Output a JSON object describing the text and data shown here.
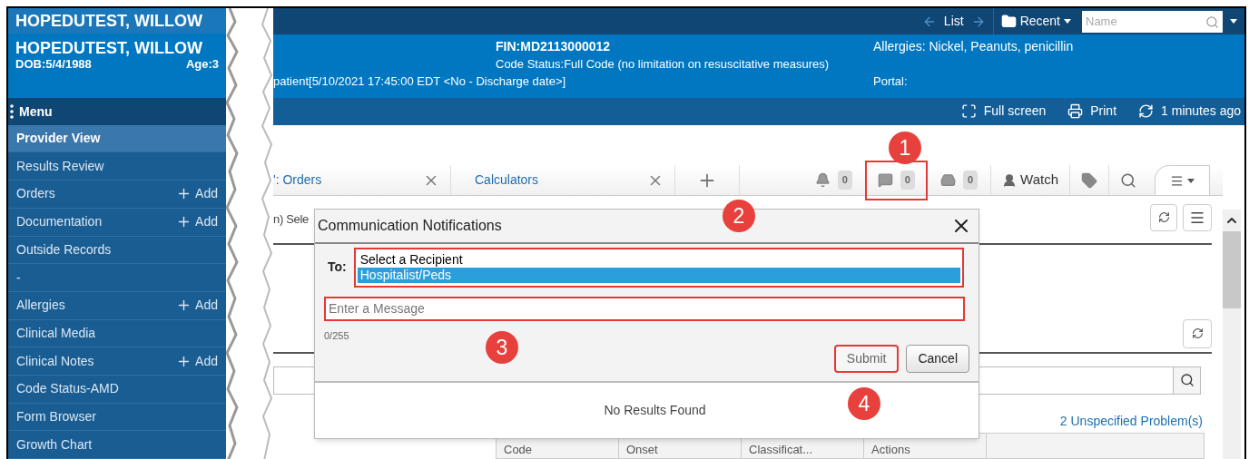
{
  "header": {
    "patient_name": "HOPEDUTEST, WILLOW",
    "nav": {
      "list": "List",
      "recent": "Recent",
      "search_placeholder": "Name"
    }
  },
  "banner": {
    "name": "HOPEDUTEST, WILLOW",
    "dob": "DOB:5/4/1988",
    "age": "Age:3",
    "encounter": "patient[5/10/2021 17:45:00 EDT <No - Discharge date>]",
    "fin": "FIN:MD2113000012",
    "code_status": "Code Status:Full Code (no limitation on resuscitative measures)",
    "allergies": "Allergies: Nickel, Peanuts, penicillin",
    "portal": "Portal:"
  },
  "menu_bar": {
    "menu": "Menu",
    "actions": [
      {
        "kind": "fullscreen",
        "label": "Full screen"
      },
      {
        "kind": "print",
        "label": "Print"
      },
      {
        "kind": "refresh",
        "label": "1 minutes ago"
      }
    ]
  },
  "sidebar": {
    "items": [
      {
        "label": "Provider View",
        "selected": true
      },
      {
        "label": "Results Review",
        "selected": false
      },
      {
        "label": "Orders",
        "selected": false,
        "add": "Add"
      },
      {
        "label": "Documentation",
        "selected": false,
        "add": "Add"
      },
      {
        "label": "Outside Records",
        "selected": false
      },
      {
        "label": "-",
        "selected": false
      },
      {
        "label": "Allergies",
        "selected": false,
        "add": "Add"
      },
      {
        "label": "Clinical Media",
        "selected": false
      },
      {
        "label": "Clinical Notes",
        "selected": false,
        "add": "Add"
      },
      {
        "label": "Code Status-AMD",
        "selected": false
      },
      {
        "label": "Form Browser",
        "selected": false
      },
      {
        "label": "Growth Chart",
        "selected": false
      }
    ]
  },
  "tabs": [
    {
      "label": "': Orders"
    },
    {
      "label": "Calculators"
    }
  ],
  "toolbar": [
    {
      "kind": "alerts",
      "count": "0",
      "highlighted": false
    },
    {
      "kind": "messages",
      "count": "0",
      "highlighted": true
    },
    {
      "kind": "inbox",
      "count": "0",
      "highlighted": false
    },
    {
      "kind": "watch",
      "label": "Watch"
    },
    {
      "kind": "tags"
    },
    {
      "kind": "search"
    },
    {
      "kind": "menu"
    }
  ],
  "content": {
    "partial_text": "n) Sele",
    "link": "2 Unspecified Problem(s)",
    "table_columns": [
      "Code",
      "Onset",
      "Classificat...",
      "Actions"
    ]
  },
  "dialog": {
    "title": "Communication Notifications",
    "to_label": "To:",
    "recipients_highlighted": true,
    "options": [
      {
        "label": "Select a Recipient",
        "selected": false
      },
      {
        "label": "Hospitalist/Peds",
        "selected": true
      }
    ],
    "message": {
      "placeholder": "Enter a Message",
      "highlighted": true
    },
    "counter": "0/255",
    "buttons": [
      {
        "label": "Submit",
        "highlighted": true
      },
      {
        "label": "Cancel",
        "highlighted": false
      }
    ],
    "no_results": "No Results Found"
  },
  "annotations": [
    "1",
    "2",
    "3",
    "4"
  ]
}
